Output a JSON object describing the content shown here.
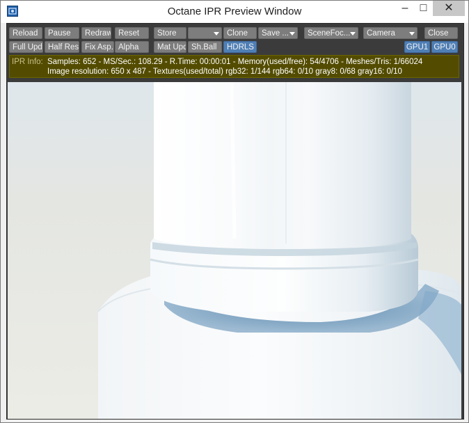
{
  "window": {
    "title": "Octane IPR Preview Window",
    "icons": {
      "app": "octane-app-icon",
      "minimize": "minimize-icon",
      "maximize": "maximize-icon",
      "close": "close-icon"
    },
    "glyphs": {
      "minimize": "–",
      "maximize": "□",
      "close": "✕"
    }
  },
  "toolbar": {
    "row1": {
      "reload": "Reload",
      "pause": "Pause",
      "redraw": "Redraw",
      "reset": "Reset",
      "store": "Store",
      "store_slot": "",
      "clone": "Clone",
      "save": "Save ...",
      "scene_focus": "SceneFoc...",
      "camera": "Camera",
      "close": "Close"
    },
    "row2": {
      "full_update": "Full Upd.",
      "half_res": "Half Res",
      "fix_aspect": "Fix Asp.",
      "alpha": "Alpha",
      "mat_update": "Mat Upd",
      "shader_ball": "Sh.Ball",
      "hdrls": "HDRLS",
      "gpu1": "GPU1",
      "gpu0": "GPU0"
    },
    "active_color": "#4f7fb5"
  },
  "ipr_info": {
    "label": "IPR Info:",
    "line1": "Samples: 652  -  MS/Sec.: 108.29  -  R.Time: 00:00:01 - Memory(used/free): 54/4706  -  Meshes/Tris: 1/66024",
    "line2": "Image resolution: 650 x 487 - Textures(used/total) rgb32: 1/144   rgb64: 0/10   gray8: 0/68   gray16: 0/10",
    "background": "#534c00"
  },
  "render": {
    "description_icon": "render-viewport"
  }
}
